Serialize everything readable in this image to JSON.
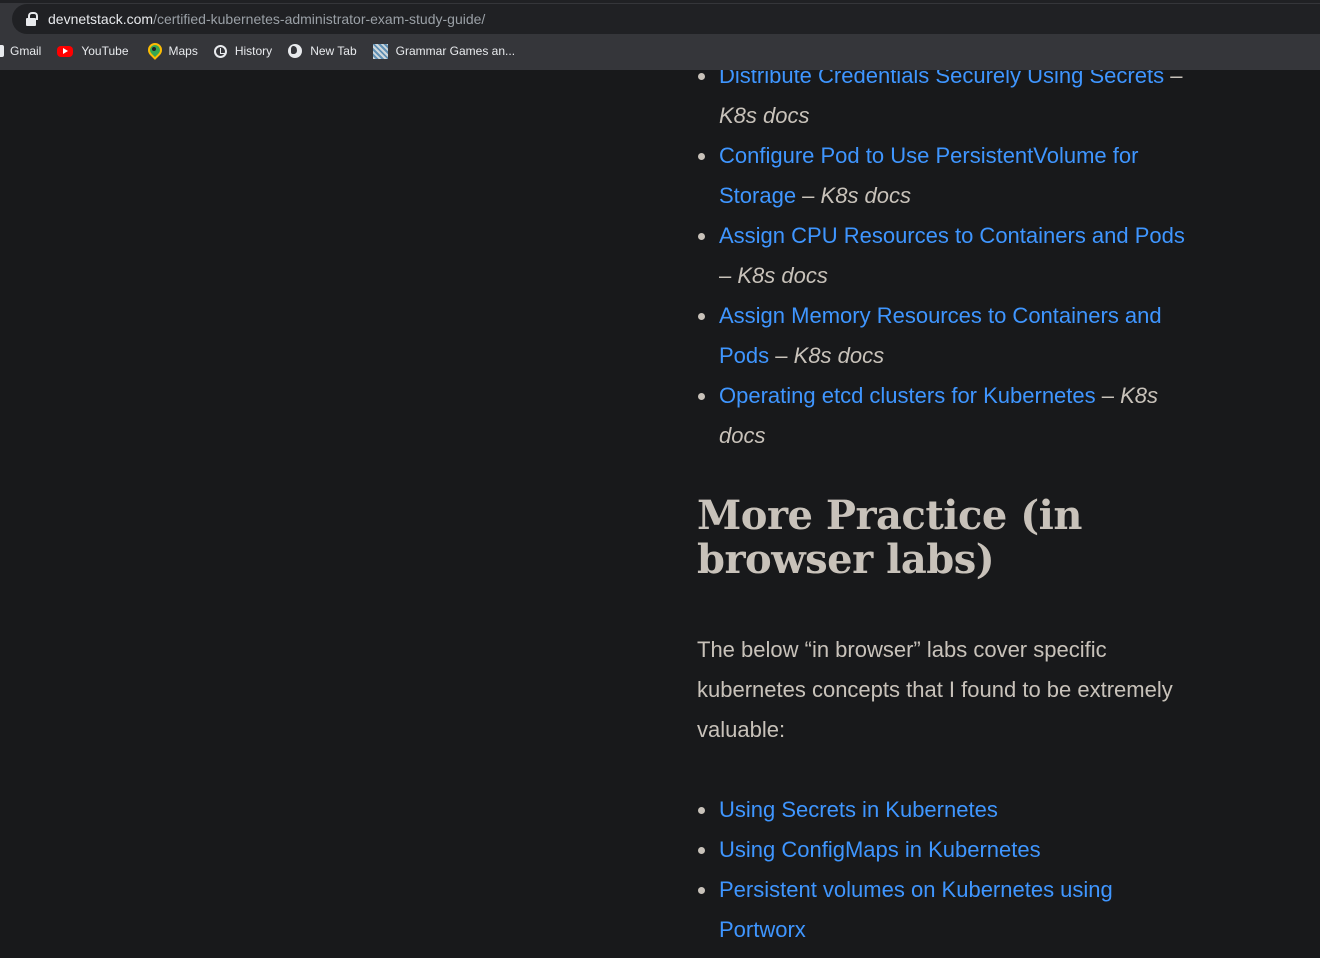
{
  "browser": {
    "url_host": "devnetstack.com",
    "url_path": "/certified-kubernetes-administrator-exam-study-guide/",
    "bookmarks": [
      {
        "label": "Gmail",
        "icon": "gmail-icon"
      },
      {
        "label": "YouTube",
        "icon": "youtube-icon"
      },
      {
        "label": "Maps",
        "icon": "maps-icon"
      },
      {
        "label": "History",
        "icon": "history-icon"
      },
      {
        "label": "New Tab",
        "icon": "globe-icon"
      },
      {
        "label": "Grammar Games an...",
        "icon": "grammar-games-icon"
      }
    ]
  },
  "article": {
    "docs_list": [
      {
        "link": "Distribute Credentials Securely Using Secrets",
        "dash": " – ",
        "source": "K8s docs"
      },
      {
        "link": "Configure Pod to Use PersistentVolume for Storage",
        "dash": " – ",
        "source": "K8s docs"
      },
      {
        "link": "Assign CPU Resources to Containers and Pods",
        "dash": " – ",
        "source": "K8s docs"
      },
      {
        "link": "Assign Memory Resources to Containers and Pods",
        "dash": " – ",
        "source": "K8s docs"
      },
      {
        "link": "Operating etcd clusters for Kubernetes",
        "dash": " – ",
        "source": "K8s docs"
      }
    ],
    "section_heading": "More Practice (in browser labs)",
    "intro_text": "The below “in browser” labs cover specific kubernetes concepts that I found to be extremely valuable:",
    "labs_list": [
      {
        "link": "Using Secrets in Kubernetes"
      },
      {
        "link": "Using ConfigMaps in Kubernetes"
      },
      {
        "link": "Persistent volumes on Kubernetes using Portworx"
      }
    ]
  },
  "colors": {
    "background": "#18191b",
    "text": "#c8c2ba",
    "link": "#3f96ff",
    "chrome": "#35363a"
  }
}
